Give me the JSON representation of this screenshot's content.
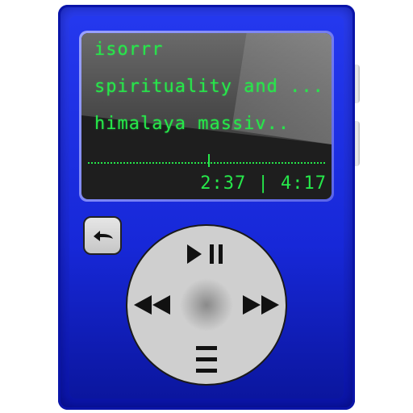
{
  "player": {
    "artist": "isorrr",
    "album": "spirituality and ...",
    "track": "himalaya massiv..",
    "time_display": "2:37 | 4:17",
    "progress_fraction": 0.51
  },
  "controls": {
    "back": "back-arrow-icon",
    "play_pause": "play-pause-icon",
    "previous": "rewind-icon",
    "next": "fast-forward-icon",
    "menu": "menu-icon"
  },
  "colors": {
    "body": "#1a2ad8",
    "lcd_text": "#26e84a",
    "screen_bg": "#1e1e1e",
    "wheel": "#cfcfcf"
  }
}
